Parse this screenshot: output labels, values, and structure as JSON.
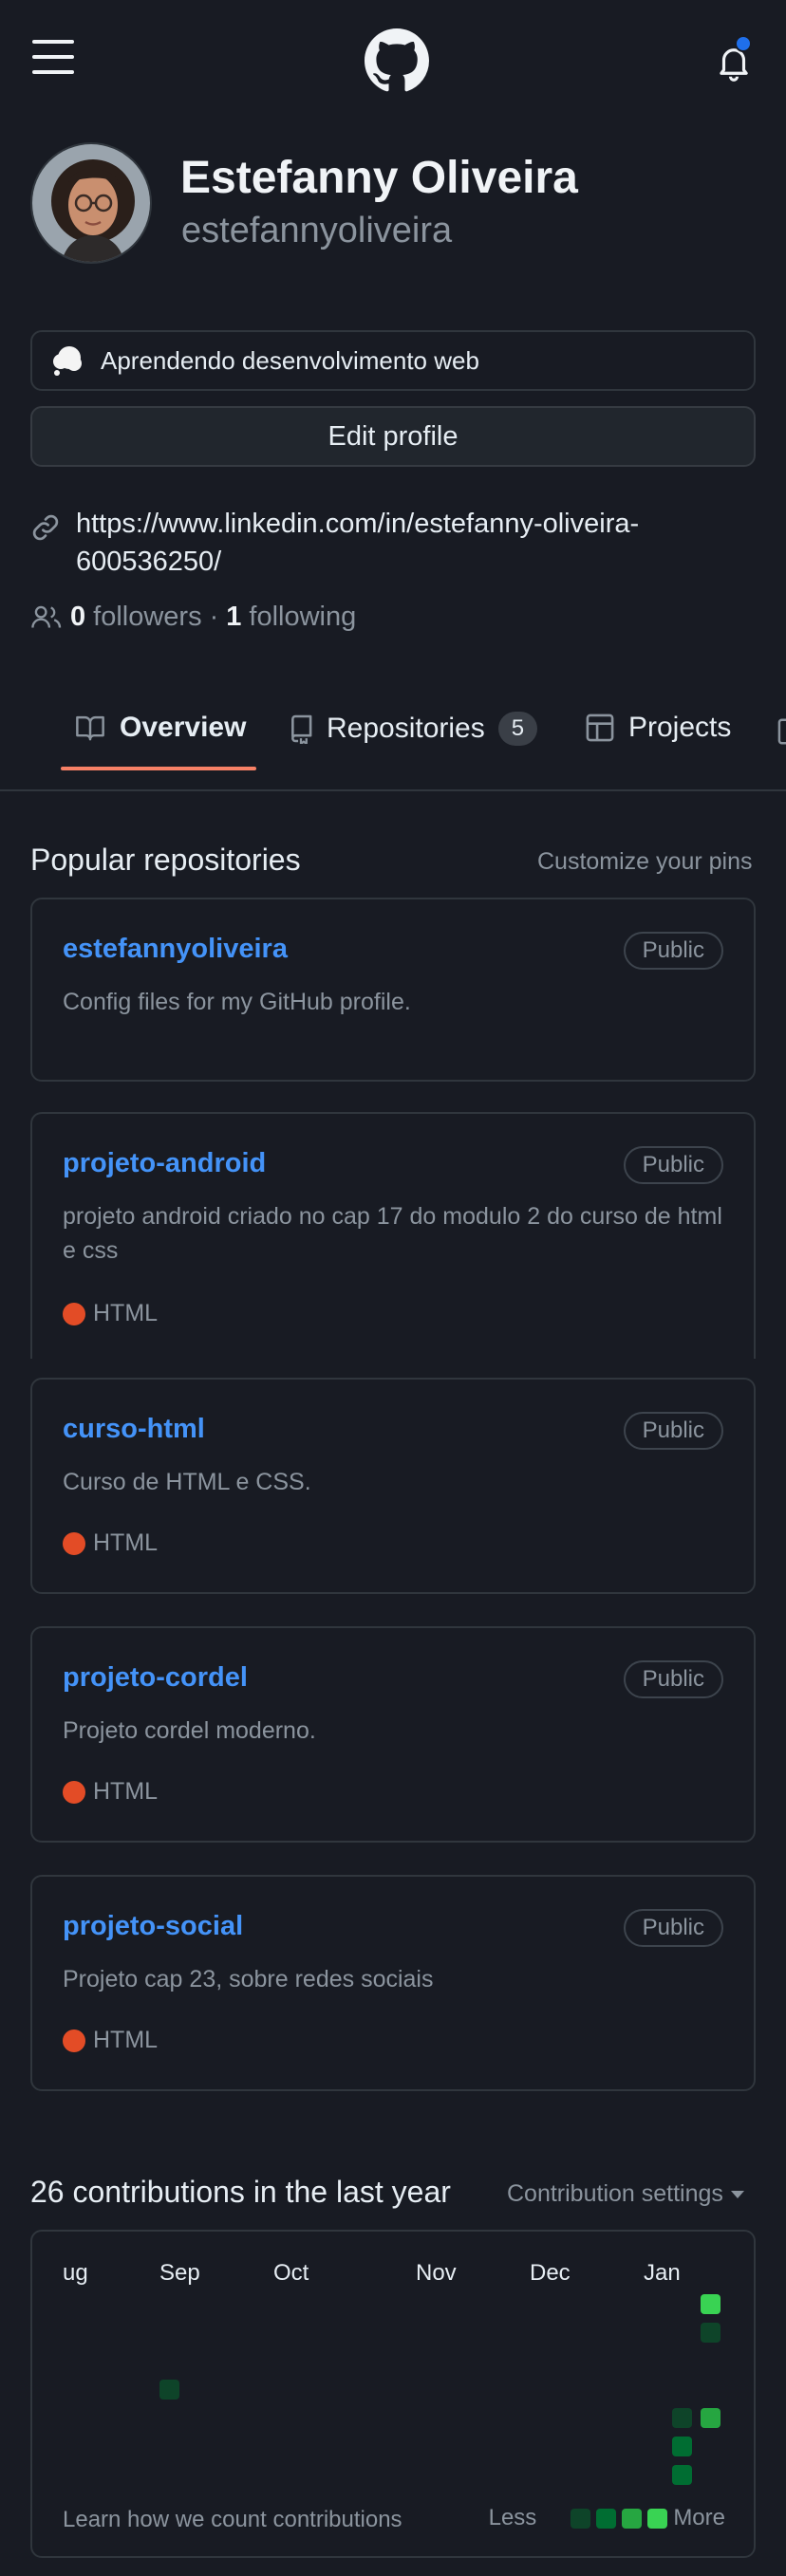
{
  "header": {
    "menu_icon": "hamburger-icon",
    "logo_icon": "github-logo-icon",
    "notification_icon": "bell-icon"
  },
  "profile": {
    "name": "Estefanny Oliveira",
    "login": "estefannyoliveira",
    "status_icon": "thought-balloon-icon",
    "status_text": "Aprendendo desenvolvimento web",
    "edit_label": "Edit profile",
    "link": "https://www.linkedin.com/in/estefanny-oliveira-600536250/",
    "followers_count": "0",
    "followers_label": "followers",
    "separator": "·",
    "following_count": "1",
    "following_label": "following"
  },
  "tabs": [
    {
      "label": "Overview",
      "icon": "book-icon",
      "selected": true
    },
    {
      "label": "Repositories",
      "icon": "repo-icon",
      "count": "5"
    },
    {
      "label": "Projects",
      "icon": "table-icon"
    }
  ],
  "popular": {
    "title": "Popular repositories",
    "customize_label": "Customize your pins",
    "repos": [
      {
        "name": "estefannyoliveira",
        "visibility": "Public",
        "description": "Config files for my GitHub profile.",
        "language": ""
      },
      {
        "name": "projeto-android",
        "visibility": "Public",
        "description": "projeto android criado no cap 17 do modulo 2 do curso de html e css",
        "language": "HTML"
      },
      {
        "name": "curso-html",
        "visibility": "Public",
        "description": "Curso de HTML e CSS.",
        "language": "HTML"
      },
      {
        "name": "projeto-cordel",
        "visibility": "Public",
        "description": "Projeto cordel moderno.",
        "language": "HTML"
      },
      {
        "name": "projeto-social",
        "visibility": "Public",
        "description": "Projeto cap 23, sobre redes sociais",
        "language": "HTML"
      }
    ],
    "language_color": "#e34c26"
  },
  "contributions": {
    "title": "26 contributions in the last year",
    "settings_label": "Contribution settings",
    "months": [
      "ug",
      "Sep",
      "Oct",
      "Nov",
      "Dec",
      "Jan"
    ],
    "learn_label": "Learn how we count contributions",
    "legend_less": "Less",
    "legend_more": "More",
    "colors": [
      "#0e4429",
      "#006d32",
      "#26a641",
      "#39d353"
    ]
  }
}
